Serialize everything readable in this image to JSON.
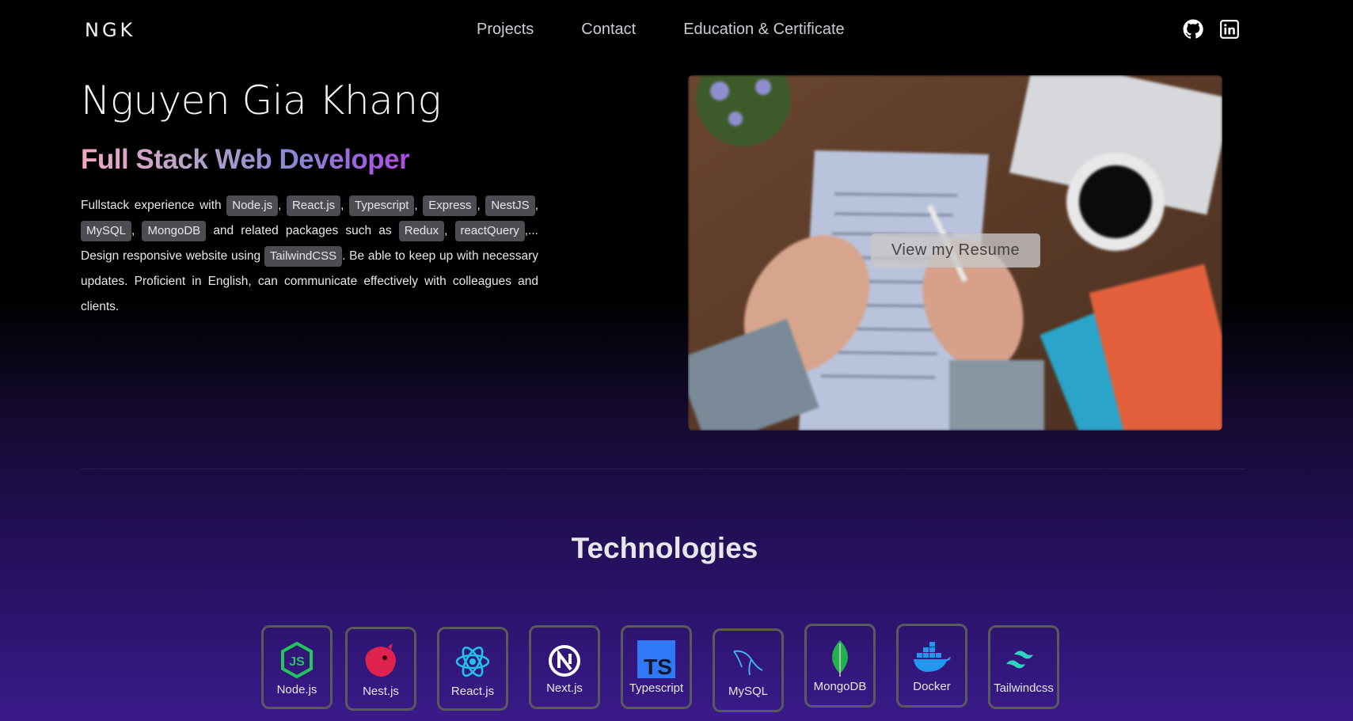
{
  "nav": {
    "logo": "NGK",
    "links": [
      "Projects",
      "Contact",
      "Education & Certificate"
    ],
    "icons": [
      "github-icon",
      "linkedin-icon"
    ]
  },
  "hero": {
    "name": "Nguyen Gia Khang",
    "role": "Full Stack Web Developer",
    "desc": {
      "t1": "Fullstack experience with",
      "tags1": [
        "Node.js",
        "React.js",
        "Typescript",
        "Express",
        "NestJS",
        "MySQL",
        "MongoDB"
      ],
      "t2": "and related packages such as",
      "tags2": [
        "Redux",
        "reactQuery"
      ],
      "t3": ",...",
      "t4": "Design responsive website using",
      "tag3": "TailwindCSS",
      "t5": ". Be able to keep up with necessary updates. Proficient in English, can communicate effectively with colleagues and clients."
    },
    "resume_button": "View my Resume"
  },
  "technologies": {
    "title": "Technologies",
    "items": [
      "Node.js",
      "Nest.js",
      "React.js",
      "Next.js",
      "Typescript",
      "MySQL",
      "MongoDB",
      "Docker",
      "Tailwindcss"
    ]
  },
  "colors": {
    "nodejs": "#3c873a",
    "nestjs": "#e0234e",
    "react": "#61dafb",
    "typescript": "#3178c6",
    "mongodb": "#13aa52",
    "docker": "#2496ed",
    "tailwind": "#38bdf8"
  }
}
